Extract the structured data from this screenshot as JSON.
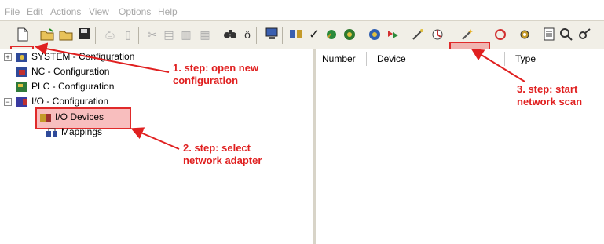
{
  "menu": [
    "File",
    "Edit",
    "Actions",
    "View",
    "Options",
    "Help"
  ],
  "toolbar": {
    "icons": [
      "new-file-icon",
      "open-folder-icon",
      "open-icon",
      "save-icon",
      "print-icon",
      "print-preview-icon",
      "cut-icon",
      "copy-icon",
      "paste-icon",
      "paste-special-icon",
      "find-icon",
      "find-next-icon",
      "monitor-icon",
      "io-device-icon",
      "check-icon",
      "build-icon",
      "activate-icon",
      "network-icon",
      "restart-icon",
      "scan-wizard-icon",
      "refresh-icon",
      "config-gear-icon",
      "sheet-icon",
      "zoom-icon",
      "search-key-icon"
    ]
  },
  "tree": {
    "items": [
      {
        "label": "SYSTEM - Configuration",
        "icon": "system-config-icon"
      },
      {
        "label": "NC - Configuration",
        "icon": "nc-config-icon"
      },
      {
        "label": "PLC - Configuration",
        "icon": "plc-config-icon"
      },
      {
        "label": "I/O - Configuration",
        "icon": "io-config-icon"
      },
      {
        "label": "I/O Devices",
        "icon": "io-devices-icon"
      },
      {
        "label": "Mappings",
        "icon": "mappings-icon"
      }
    ]
  },
  "list": {
    "columns": [
      "Number",
      "Device",
      "Type"
    ]
  },
  "annotations": {
    "step1": {
      "line1": "1. step: open new",
      "line2": "configuration"
    },
    "step2": {
      "line1": "2. step: select",
      "line2": "network adapter"
    },
    "step3": {
      "line1": "3. step: start",
      "line2": "network scan"
    }
  },
  "colors": {
    "annotation": "#e02020",
    "highlight": "#f06e6e"
  }
}
